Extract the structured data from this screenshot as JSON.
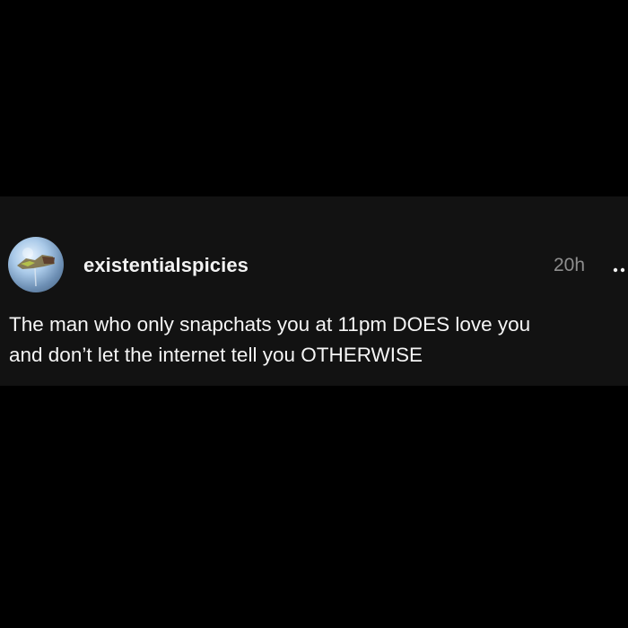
{
  "post": {
    "username": "existentialspicies",
    "timestamp": "20h",
    "text_lines": [
      "The man who only snapchats you at 11pm DOES love you",
      "and don’t let the internet tell you OTHERWISE"
    ],
    "avatar_icon": "profile-avatar",
    "more_icon": "more-options-icon"
  },
  "colors": {
    "background": "#000000",
    "post_background": "#121212",
    "text": "#f5f5f5",
    "muted": "#8e8e8e"
  }
}
